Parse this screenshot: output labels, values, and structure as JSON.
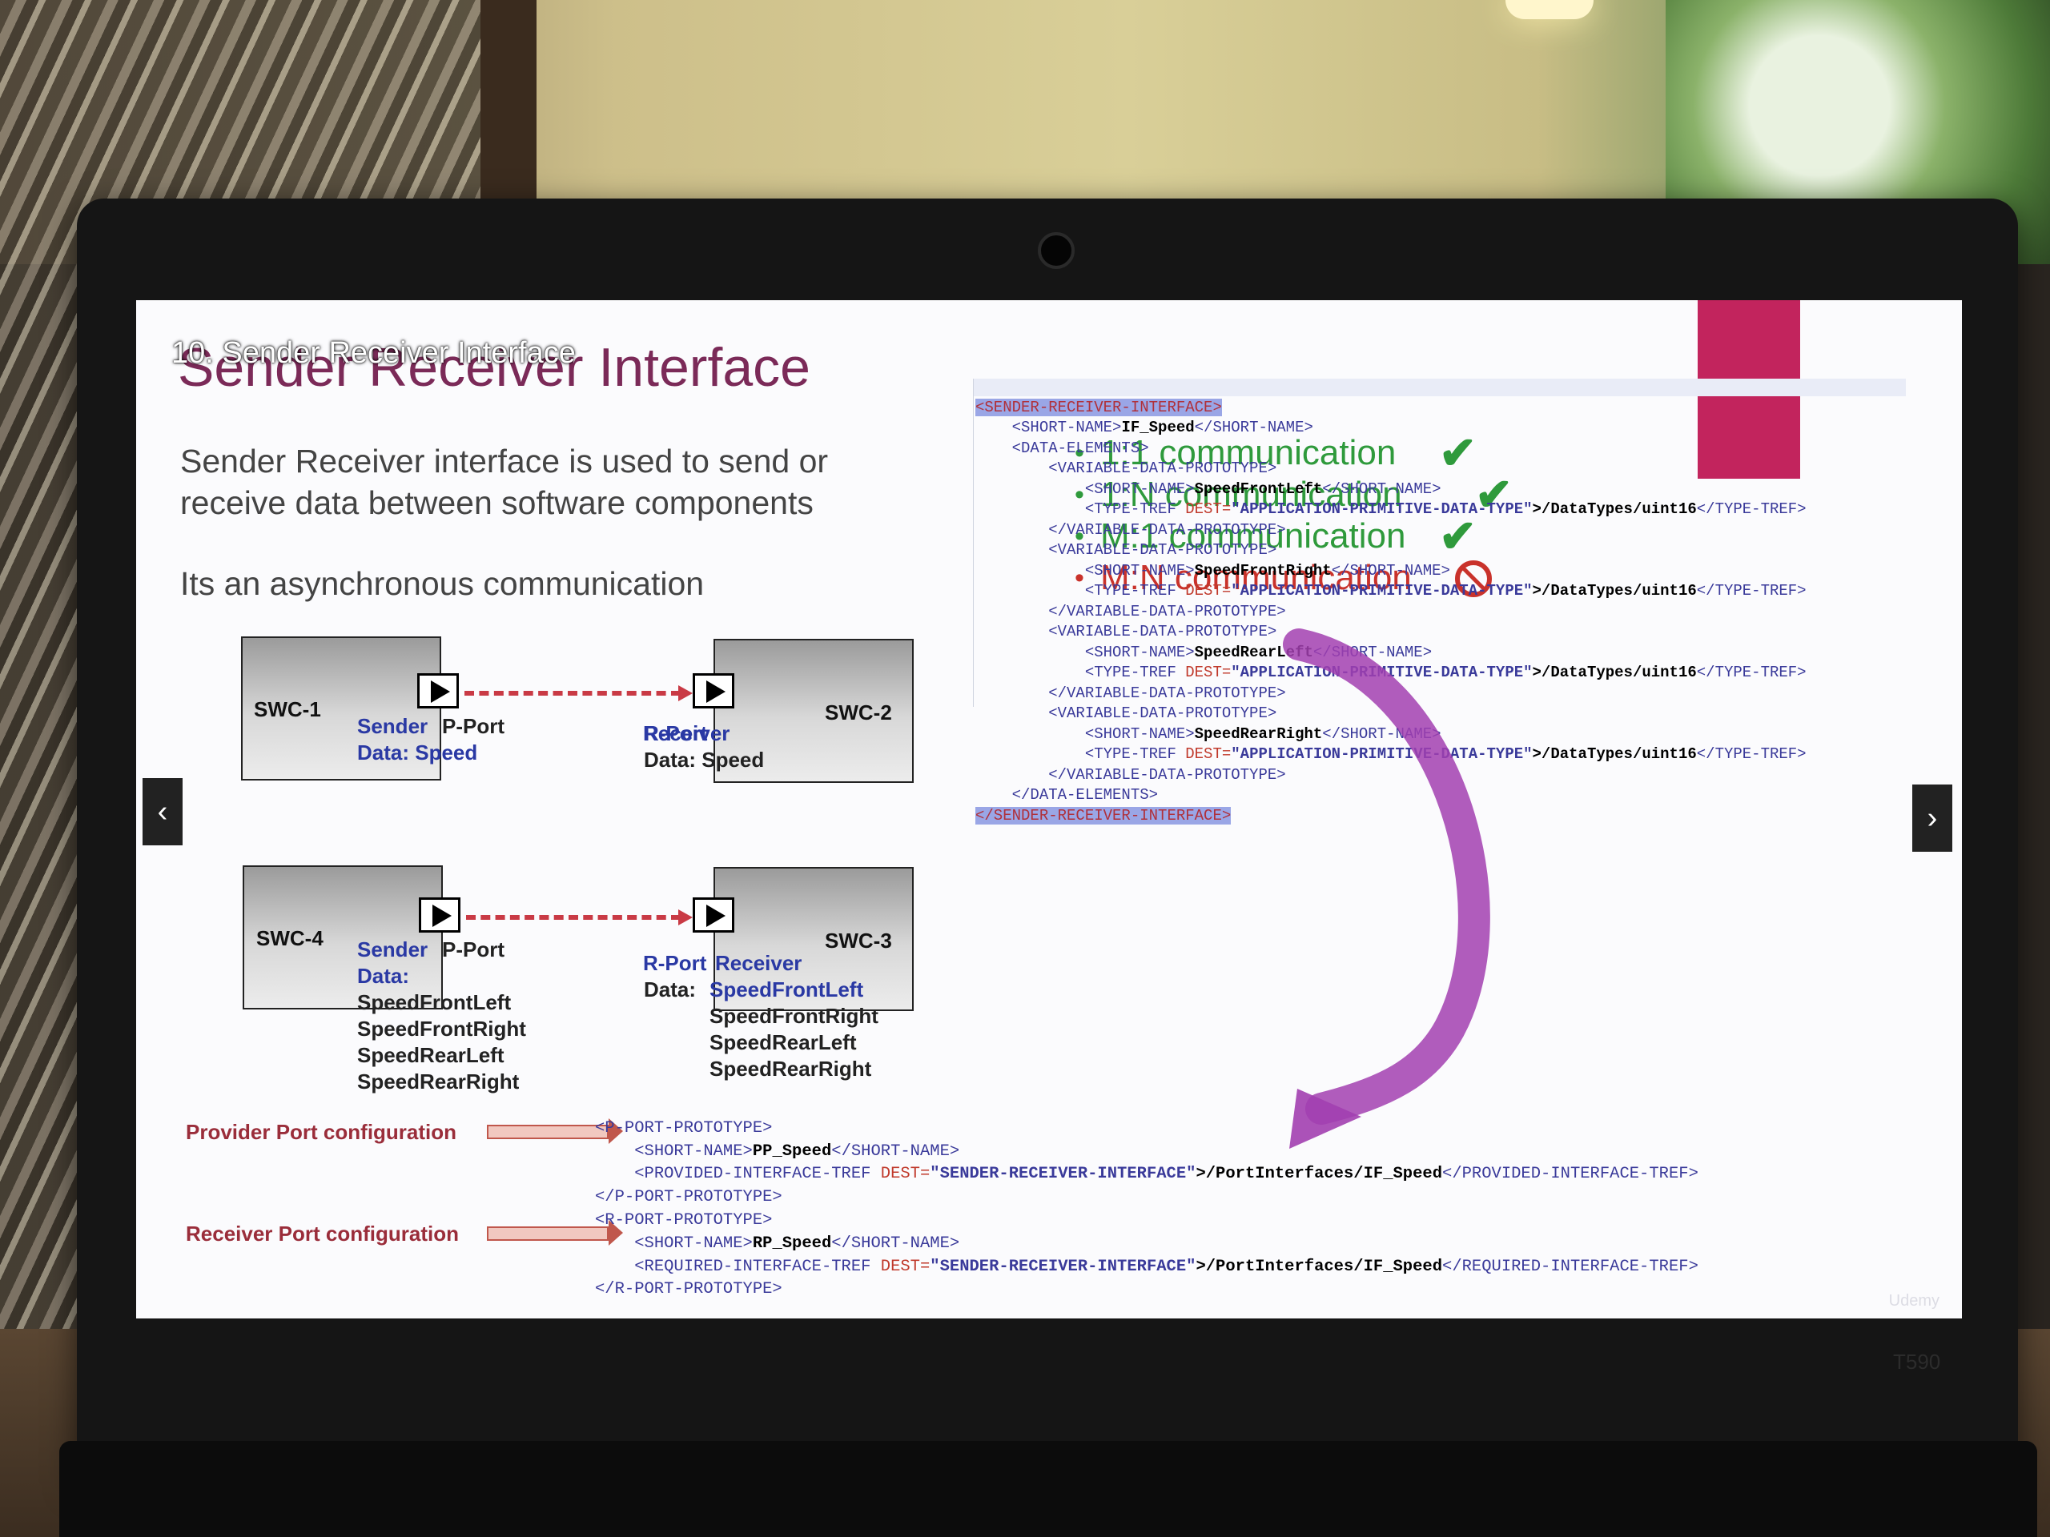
{
  "slide": {
    "overlay_title": "10. Sender Receiver Interface",
    "title": "Sender Receiver Interface",
    "intro_line1": "Sender Receiver interface is used to send or",
    "intro_line2": "receive data between software components",
    "async": "Its an asynchronous communication"
  },
  "communication": [
    {
      "label": "1:1 communication",
      "supported": true
    },
    {
      "label": "1:N communication",
      "supported": true
    },
    {
      "label": "M:1 communication",
      "supported": true
    },
    {
      "label": "M:N communication",
      "supported": false
    }
  ],
  "diagram": {
    "swc1": "SWC-1",
    "swc2": "SWC-2",
    "swc3": "SWC-3",
    "swc4": "SWC-4",
    "sender": "Sender",
    "p_port": "P-Port",
    "r_port": "R-Port",
    "receiver": "Receiver",
    "data_speed_1": "Data: Speed",
    "data_speed_2": "Data: Speed",
    "data_label": "Data:",
    "data_label_r": "Data:",
    "elements": [
      "SpeedFrontLeft",
      "SpeedFrontRight",
      "SpeedRearLeft",
      "SpeedRearRight"
    ]
  },
  "xml_interface": [
    "<SENDER-RECEIVER-INTERFACE>",
    "<SHORT-NAME>",
    "IF_Speed",
    "</SHORT-NAME>",
    "<DATA-ELEMENTS>",
    "<VARIABLE-DATA-PROTOTYPE>",
    "</VARIABLE-DATA-PROTOTYPE>",
    "<TYPE-TREF ",
    "DEST=",
    "\"APPLICATION-PRIMITIVE-DATA-TYPE\"",
    ">/DataTypes/uint16",
    "</TYPE-TREF>",
    "</DATA-ELEMENTS>",
    "</SENDER-RECEIVER-INTERFACE>"
  ],
  "xml_ports": {
    "p_open": "<P-PORT-PROTOTYPE>",
    "p_name": "PP_Speed",
    "p_tref": "<PROVIDED-INTERFACE-TREF ",
    "p_tref_close": "</PROVIDED-INTERFACE-TREF>",
    "p_close": "</P-PORT-PROTOTYPE>",
    "r_open": "<R-PORT-PROTOTYPE>",
    "r_name": "RP_Speed",
    "r_tref": "<REQUIRED-INTERFACE-TREF ",
    "r_tref_close": "</REQUIRED-INTERFACE-TREF>",
    "r_close": "</R-PORT-PROTOTYPE>",
    "dest": "DEST=",
    "dest_value": "\"SENDER-RECEIVER-INTERFACE\"",
    "path": ">/PortInterfaces/IF_Speed",
    "short_open": "<SHORT-NAME>",
    "short_close": "</SHORT-NAME>"
  },
  "config": {
    "provider": "Provider Port configuration",
    "receiver": "Receiver Port configuration"
  },
  "nav": {
    "prev": "‹",
    "next": "›"
  },
  "laptop_model": "T590",
  "watermark": "Udemy",
  "colors": {
    "title": "#7b2a58",
    "accent": "#c2245d",
    "check": "#2f9a3c",
    "forbidden": "#c9322b",
    "port_link": "#c93a45",
    "arc": "#a23fb0"
  }
}
